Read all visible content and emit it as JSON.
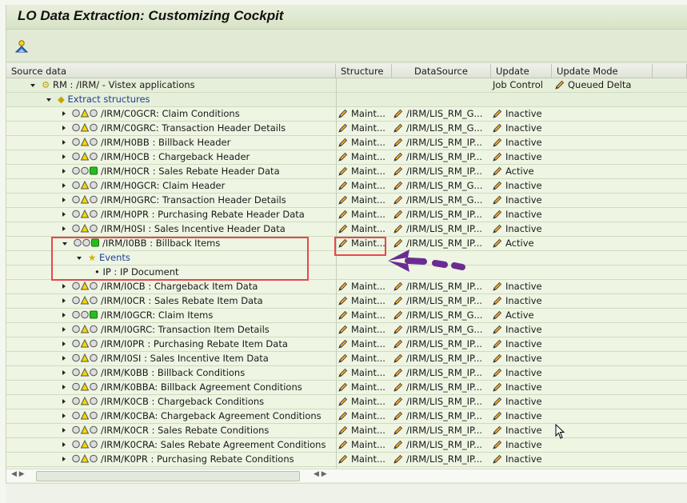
{
  "title": "LO Data Extraction: Customizing Cockpit",
  "toolbar": {
    "icon": "maintain-icon"
  },
  "columns": [
    "Source data",
    "Structure",
    "DataSource",
    "Update",
    "Update Mode"
  ],
  "app_row": {
    "label": "RM : /IRM/  - Vistex applications",
    "update": "Job Control",
    "update_mode": "Queued Delta"
  },
  "extract_label": "Extract structures",
  "rows": [
    {
      "name": "/IRM/C0GCR: Claim Conditions",
      "structure": "Maint...",
      "datasource": "/IRM/LIS_RM_G...",
      "update": "Inactive",
      "light": "yellow"
    },
    {
      "name": "/IRM/C0GRC: Transaction Header Details",
      "structure": "Maint...",
      "datasource": "/IRM/LIS_RM_G...",
      "update": "Inactive",
      "light": "yellow"
    },
    {
      "name": "/IRM/H0BB : Billback Header",
      "structure": "Maint...",
      "datasource": "/IRM/LIS_RM_IP...",
      "update": "Inactive",
      "light": "yellow"
    },
    {
      "name": "/IRM/H0CB : Chargeback Header",
      "structure": "Maint...",
      "datasource": "/IRM/LIS_RM_IP...",
      "update": "Inactive",
      "light": "yellow"
    },
    {
      "name": "/IRM/H0CR : Sales Rebate Header Data",
      "structure": "Maint...",
      "datasource": "/IRM/LIS_RM_IP...",
      "update": "Active",
      "light": "green"
    },
    {
      "name": "/IRM/H0GCR: Claim Header",
      "structure": "Maint...",
      "datasource": "/IRM/LIS_RM_G...",
      "update": "Inactive",
      "light": "yellow"
    },
    {
      "name": "/IRM/H0GRC: Transaction Header Details",
      "structure": "Maint...",
      "datasource": "/IRM/LIS_RM_G...",
      "update": "Inactive",
      "light": "yellow"
    },
    {
      "name": "/IRM/H0PR : Purchasing Rebate Header Data",
      "structure": "Maint...",
      "datasource": "/IRM/LIS_RM_IP...",
      "update": "Inactive",
      "light": "yellow"
    },
    {
      "name": "/IRM/H0SI : Sales Incentive Header Data",
      "structure": "Maint...",
      "datasource": "/IRM/LIS_RM_IP...",
      "update": "Inactive",
      "light": "yellow"
    },
    {
      "name": "/IRM/I0BB : Billback Items",
      "structure": "Maint...",
      "datasource": "/IRM/LIS_RM_IP...",
      "update": "Active",
      "light": "green",
      "expanded": true
    },
    {
      "events": "Events"
    },
    {
      "event": "IP : IP Document"
    },
    {
      "name": "/IRM/I0CB : Chargeback Item Data",
      "structure": "Maint...",
      "datasource": "/IRM/LIS_RM_IP...",
      "update": "Inactive",
      "light": "yellow"
    },
    {
      "name": "/IRM/I0CR : Sales Rebate Item Data",
      "structure": "Maint...",
      "datasource": "/IRM/LIS_RM_IP...",
      "update": "Inactive",
      "light": "yellow"
    },
    {
      "name": "/IRM/I0GCR: Claim Items",
      "structure": "Maint...",
      "datasource": "/IRM/LIS_RM_G...",
      "update": "Active",
      "light": "green"
    },
    {
      "name": "/IRM/I0GRC: Transaction Item Details",
      "structure": "Maint...",
      "datasource": "/IRM/LIS_RM_G...",
      "update": "Inactive",
      "light": "yellow"
    },
    {
      "name": "/IRM/I0PR : Purchasing Rebate Item Data",
      "structure": "Maint...",
      "datasource": "/IRM/LIS_RM_IP...",
      "update": "Inactive",
      "light": "yellow"
    },
    {
      "name": "/IRM/I0SI : Sales Incentive Item Data",
      "structure": "Maint...",
      "datasource": "/IRM/LIS_RM_IP...",
      "update": "Inactive",
      "light": "yellow"
    },
    {
      "name": "/IRM/K0BB : Billback Conditions",
      "structure": "Maint...",
      "datasource": "/IRM/LIS_RM_IP...",
      "update": "Inactive",
      "light": "yellow"
    },
    {
      "name": "/IRM/K0BBA: Billback Agreement Conditions",
      "structure": "Maint...",
      "datasource": "/IRM/LIS_RM_IP...",
      "update": "Inactive",
      "light": "yellow"
    },
    {
      "name": "/IRM/K0CB : Chargeback Conditions",
      "structure": "Maint...",
      "datasource": "/IRM/LIS_RM_IP...",
      "update": "Inactive",
      "light": "yellow"
    },
    {
      "name": "/IRM/K0CBA: Chargeback Agreement Conditions",
      "structure": "Maint...",
      "datasource": "/IRM/LIS_RM_IP...",
      "update": "Inactive",
      "light": "yellow"
    },
    {
      "name": "/IRM/K0CR : Sales Rebate Conditions",
      "structure": "Maint...",
      "datasource": "/IRM/LIS_RM_IP...",
      "update": "Inactive",
      "light": "yellow"
    },
    {
      "name": "/IRM/K0CRA: Sales Rebate Agreement Conditions",
      "structure": "Maint...",
      "datasource": "/IRM/LIS_RM_IP...",
      "update": "Inactive",
      "light": "yellow"
    },
    {
      "name": "/IRM/K0PR : Purchasing Rebate Conditions",
      "structure": "Maint...",
      "datasource": "/IRM/LIS_RM_IP...",
      "update": "Inactive",
      "light": "yellow"
    }
  ],
  "colors": {
    "highlight": "#e8474d",
    "arrow": "#6a2c91",
    "active_light": "#22c01a",
    "warning_light": "#f5d800"
  }
}
